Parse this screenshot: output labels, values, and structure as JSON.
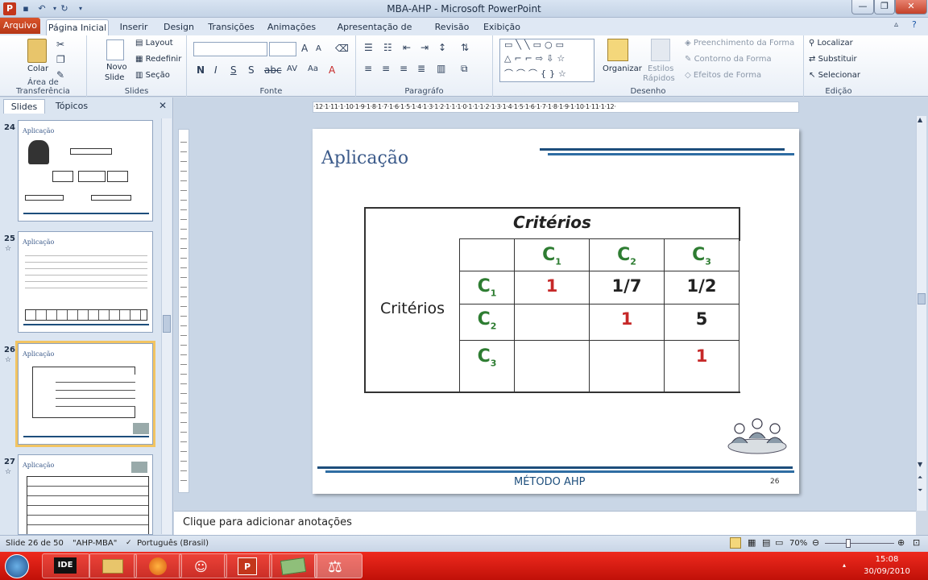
{
  "window": {
    "title": "MBA-AHP - Microsoft PowerPoint"
  },
  "tabs": {
    "file": "Arquivo",
    "items": [
      "Página Inicial",
      "Inserir",
      "Design",
      "Transições",
      "Animações",
      "Apresentação de Slides",
      "Revisão",
      "Exibição"
    ],
    "active": "Página Inicial"
  },
  "ribbon": {
    "clipboard": {
      "label": "Área de Transferência",
      "paste": "Colar"
    },
    "slides": {
      "label": "Slides",
      "new_slide_1": "Novo",
      "new_slide_2": "Slide",
      "layout": "Layout",
      "reset": "Redefinir",
      "section": "Seção"
    },
    "font": {
      "label": "Fonte"
    },
    "paragraph": {
      "label": "Paragráfo"
    },
    "drawing": {
      "label": "Desenho",
      "arrange": "Organizar",
      "quick_styles_1": "Estilos",
      "quick_styles_2": "Rápidos",
      "shape_fill": "Preenchimento da Forma",
      "shape_outline": "Contorno da Forma",
      "shape_effects": "Efeitos de Forma"
    },
    "editing": {
      "label": "Edição",
      "find": "Localizar",
      "replace": "Substituir",
      "select": "Selecionar"
    }
  },
  "panel": {
    "tab_slides": "Slides",
    "tab_outline": "Tópicos"
  },
  "thumbnails": [
    {
      "num": "24",
      "title": "Aplicação"
    },
    {
      "num": "25",
      "title": "Aplicação"
    },
    {
      "num": "26",
      "title": "Aplicação"
    },
    {
      "num": "27",
      "title": "Aplicação"
    }
  ],
  "ruler": {
    "h": "·12·1·11·1·10·1·9·1·8·1·7·1·6·1·5·1·4·1·3·1·2·1·1·1·0·1·1·1·2·1·3·1·4·1·5·1·6·1·7·1·8·1·9·1·10·1·11·1·12·"
  },
  "slide": {
    "title": "Aplicação",
    "table": {
      "header": "Critérios",
      "row_label": "Critérios",
      "cols": [
        "C",
        "C",
        "C"
      ],
      "col_subs": [
        "1",
        "2",
        "3"
      ],
      "rows": [
        "C",
        "C",
        "C"
      ],
      "row_subs": [
        "1",
        "2",
        "3"
      ],
      "cells": [
        [
          "1",
          "1/7",
          "1/2"
        ],
        [
          "",
          "1",
          "5"
        ],
        [
          "",
          "",
          "1"
        ]
      ]
    },
    "footer": "MÉTODO AHP",
    "page": "26"
  },
  "notes": {
    "placeholder": "Clique para adicionar anotações"
  },
  "status": {
    "slide": "Slide 26 de 50",
    "theme": "\"AHP-MBA\"",
    "language": "Português (Brasil)",
    "zoom": "70%"
  },
  "taskbar": {
    "time": "15:08",
    "date": "30/09/2010"
  },
  "colors": {
    "accent": "#1d4e7c",
    "green": "#2e7d32",
    "red": "#c62828",
    "taskbar": "#d4170d"
  }
}
